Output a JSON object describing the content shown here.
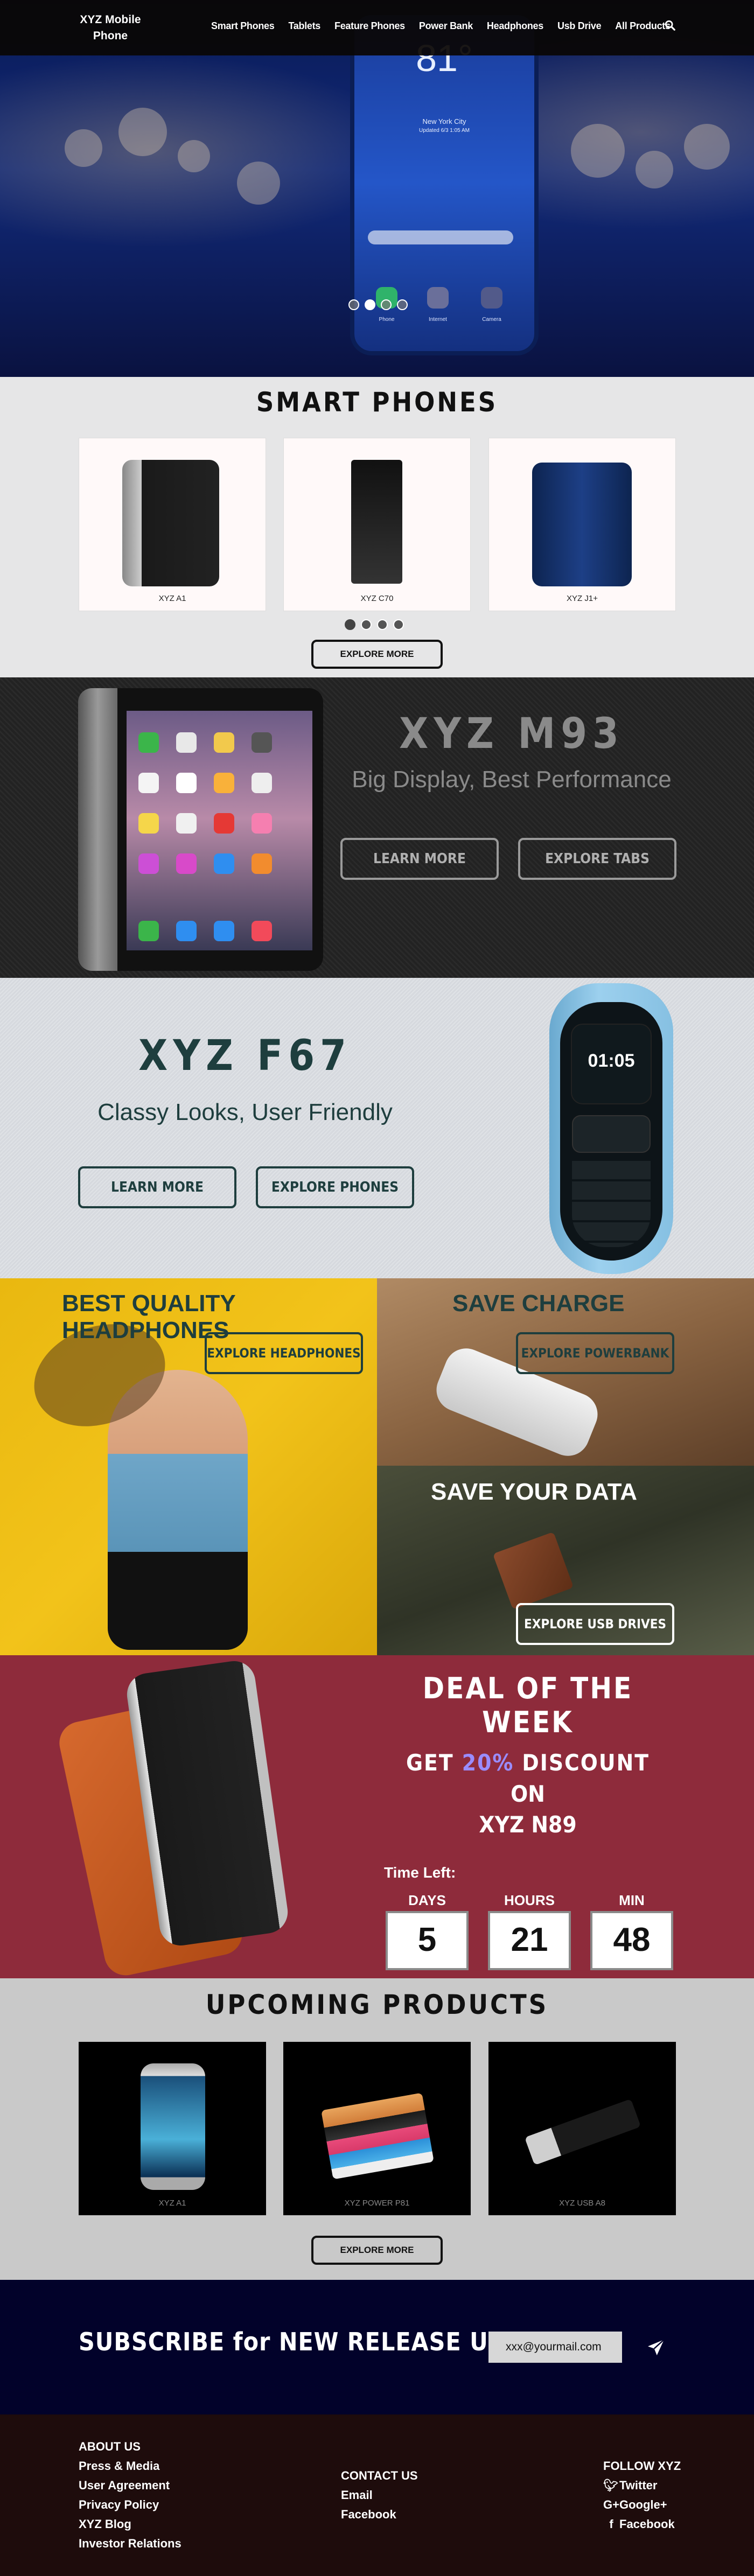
{
  "nav": {
    "logo_line1": "XYZ Mobile",
    "logo_line2": "Phone",
    "links": [
      "Smart Phones",
      "Tablets",
      "Feature Phones",
      "Power Bank",
      "Headphones",
      "Usb Drive",
      "All Products"
    ],
    "search_icon": "search-icon"
  },
  "hero": {
    "temp": "81°",
    "city": "New York City",
    "updated": "Updated 6/3 1:05 AM",
    "apps": [
      "Phone",
      "Internet",
      "Camera"
    ],
    "slides": 4,
    "active_slide": 2
  },
  "smart_phones": {
    "title": "SMART PHONES",
    "products": [
      "XYZ A1",
      "XYZ C70",
      "XYZ J1+"
    ],
    "slides": 4,
    "active_slide": 1,
    "button": "EXPLORE MORE"
  },
  "m93": {
    "title": "XYZ  M93",
    "subtitle": "Big Display, Best Performance",
    "learn": "LEARN MORE",
    "explore": "EXPLORE TABS"
  },
  "f67": {
    "title": "XYZ  F67",
    "subtitle": "Classy Looks, User Friendly",
    "learn": "LEARN MORE",
    "explore": "EXPLORE PHONES",
    "screen_time": "01:05"
  },
  "promo": {
    "headphones_title": "BEST QUALITY HEADPHONES",
    "headphones_btn": "EXPLORE HEADPHONES",
    "charge_title": "SAVE CHARGE",
    "charge_btn": "EXPLORE POWERBANK",
    "data_title": "SAVE YOUR DATA",
    "data_btn": "EXPLORE USB DRIVES"
  },
  "deal": {
    "title": "DEAL OF THE WEEK",
    "get": "GET",
    "percent": "20%",
    "discount": "DISCOUNT",
    "on": "ON",
    "product": "XYZ N89",
    "time_left": "Time Left:",
    "days_label": "DAYS",
    "hours_label": "HOURS",
    "min_label": "MIN",
    "days": "5",
    "hours": "21",
    "min": "48"
  },
  "upcoming": {
    "title": "UPCOMING PRODUCTS",
    "products": [
      "XYZ A1",
      "XYZ POWER P81",
      "XYZ USB A8"
    ],
    "button": "EXPLORE MORE"
  },
  "subscribe": {
    "title": "SUBSCRIBE for NEW RELEASE UPDATES",
    "email": "xxx@yourmail.com"
  },
  "footer": {
    "col1": [
      "ABOUT US",
      "Press & Media",
      "User Agreement",
      "Privacy Policy",
      "XYZ Blog",
      "Investor Relations"
    ],
    "col2": [
      "CONTACT US",
      "Email",
      "Facebook"
    ],
    "follow_title": "FOLLOW XYZ",
    "social": [
      "Twitter",
      "Google+",
      "Facebook"
    ]
  }
}
